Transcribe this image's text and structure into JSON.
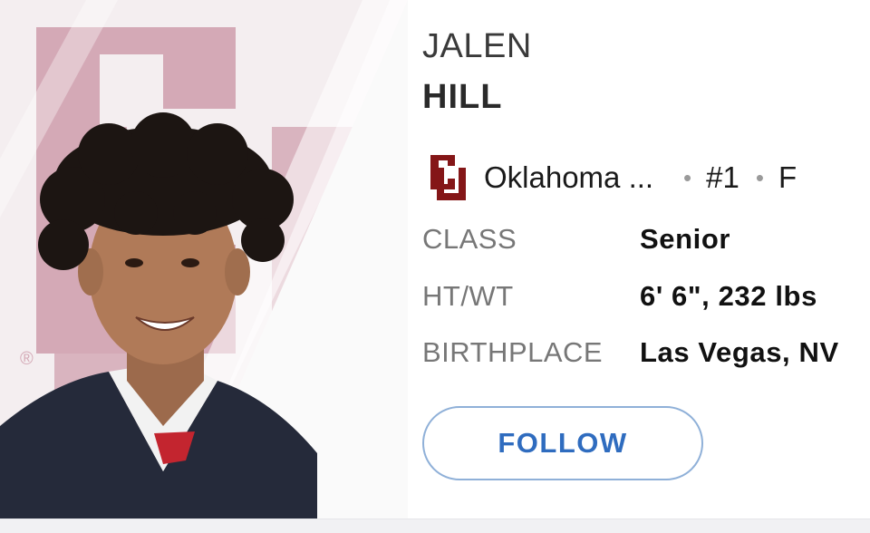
{
  "player": {
    "first_name": "JALEN",
    "last_name": "HILL",
    "team": "Oklahoma ...",
    "jersey": "#1",
    "position": "F"
  },
  "separators": {
    "dot": "•"
  },
  "details": [
    {
      "label": "CLASS",
      "value": "Senior"
    },
    {
      "label": "HT/WT",
      "value": "6' 6\", 232 lbs"
    },
    {
      "label": "BIRTHPLACE",
      "value": "Las Vegas, NV"
    }
  ],
  "actions": {
    "follow_label": "FOLLOW"
  },
  "colors": {
    "team_crimson": "#841617",
    "logo_watermark": "#d4a9b6",
    "follow_text": "#2f6cbf",
    "follow_border": "#8fb0d8"
  },
  "icons": {
    "team_logo": "ou-logo-icon"
  }
}
